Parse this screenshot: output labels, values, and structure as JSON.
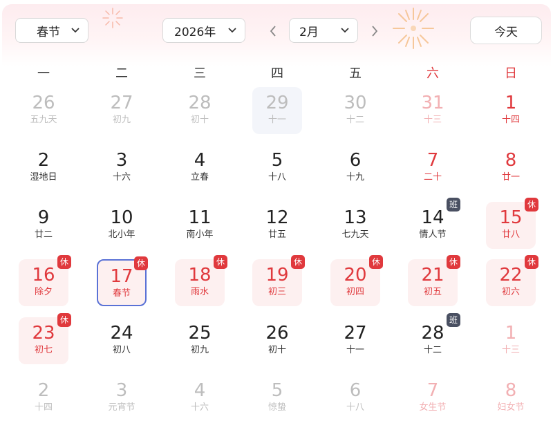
{
  "header": {
    "holiday_select": "春节",
    "year_select": "2026年",
    "month_select": "2月",
    "today_button": "今天"
  },
  "weekdays": [
    {
      "label": "一",
      "red": false
    },
    {
      "label": "二",
      "red": false
    },
    {
      "label": "三",
      "red": false
    },
    {
      "label": "四",
      "red": false
    },
    {
      "label": "五",
      "red": false
    },
    {
      "label": "六",
      "red": true
    },
    {
      "label": "日",
      "red": true
    }
  ],
  "weeks": [
    [
      {
        "day": "26",
        "lunar": "五九天",
        "state": "dim"
      },
      {
        "day": "27",
        "lunar": "初九",
        "state": "dim"
      },
      {
        "day": "28",
        "lunar": "初十",
        "state": "dim"
      },
      {
        "day": "29",
        "lunar": "十一",
        "state": "dim",
        "current": true
      },
      {
        "day": "30",
        "lunar": "十二",
        "state": "dim"
      },
      {
        "day": "31",
        "lunar": "十三",
        "state": "dimred"
      },
      {
        "day": "1",
        "lunar": "十四",
        "state": "red-day"
      }
    ],
    [
      {
        "day": "2",
        "lunar": "湿地日"
      },
      {
        "day": "3",
        "lunar": "十六"
      },
      {
        "day": "4",
        "lunar": "立春"
      },
      {
        "day": "5",
        "lunar": "十八"
      },
      {
        "day": "6",
        "lunar": "十九"
      },
      {
        "day": "7",
        "lunar": "二十",
        "state": "red"
      },
      {
        "day": "8",
        "lunar": "廿一",
        "state": "red"
      }
    ],
    [
      {
        "day": "9",
        "lunar": "廿二"
      },
      {
        "day": "10",
        "lunar": "北小年"
      },
      {
        "day": "11",
        "lunar": "南小年"
      },
      {
        "day": "12",
        "lunar": "廿五"
      },
      {
        "day": "13",
        "lunar": "七九天"
      },
      {
        "day": "14",
        "lunar": "情人节",
        "badge": "班"
      },
      {
        "day": "15",
        "lunar": "廿八",
        "state": "red",
        "holiday": true,
        "badge": "休"
      }
    ],
    [
      {
        "day": "16",
        "lunar": "除夕",
        "state": "red",
        "holiday": true,
        "badge": "休"
      },
      {
        "day": "17",
        "lunar": "春节",
        "state": "red",
        "holiday": true,
        "badge": "休",
        "selected": true
      },
      {
        "day": "18",
        "lunar": "雨水",
        "state": "red",
        "holiday": true,
        "badge": "休"
      },
      {
        "day": "19",
        "lunar": "初三",
        "state": "red",
        "holiday": true,
        "badge": "休"
      },
      {
        "day": "20",
        "lunar": "初四",
        "state": "red",
        "holiday": true,
        "badge": "休"
      },
      {
        "day": "21",
        "lunar": "初五",
        "state": "red",
        "holiday": true,
        "badge": "休"
      },
      {
        "day": "22",
        "lunar": "初六",
        "state": "red",
        "holiday": true,
        "badge": "休"
      }
    ],
    [
      {
        "day": "23",
        "lunar": "初七",
        "state": "red",
        "holiday": true,
        "badge": "休"
      },
      {
        "day": "24",
        "lunar": "初八"
      },
      {
        "day": "25",
        "lunar": "初九"
      },
      {
        "day": "26",
        "lunar": "初十"
      },
      {
        "day": "27",
        "lunar": "十一"
      },
      {
        "day": "28",
        "lunar": "十二",
        "badge": "班"
      },
      {
        "day": "1",
        "lunar": "十三",
        "state": "dimred"
      }
    ],
    [
      {
        "day": "2",
        "lunar": "十四",
        "state": "dim"
      },
      {
        "day": "3",
        "lunar": "元宵节",
        "state": "dim"
      },
      {
        "day": "4",
        "lunar": "十六",
        "state": "dim"
      },
      {
        "day": "5",
        "lunar": "惊蛰",
        "state": "dim"
      },
      {
        "day": "6",
        "lunar": "十八",
        "state": "dim"
      },
      {
        "day": "7",
        "lunar": "女生节",
        "state": "dimred"
      },
      {
        "day": "8",
        "lunar": "妇女节",
        "state": "dimred"
      }
    ]
  ],
  "colors": {
    "holiday_red": "#e0393d",
    "holiday_bg": "#fdf0f0",
    "rest_badge": "#e0393d",
    "work_badge": "#4a5062",
    "selected_border": "#5a72d6"
  }
}
